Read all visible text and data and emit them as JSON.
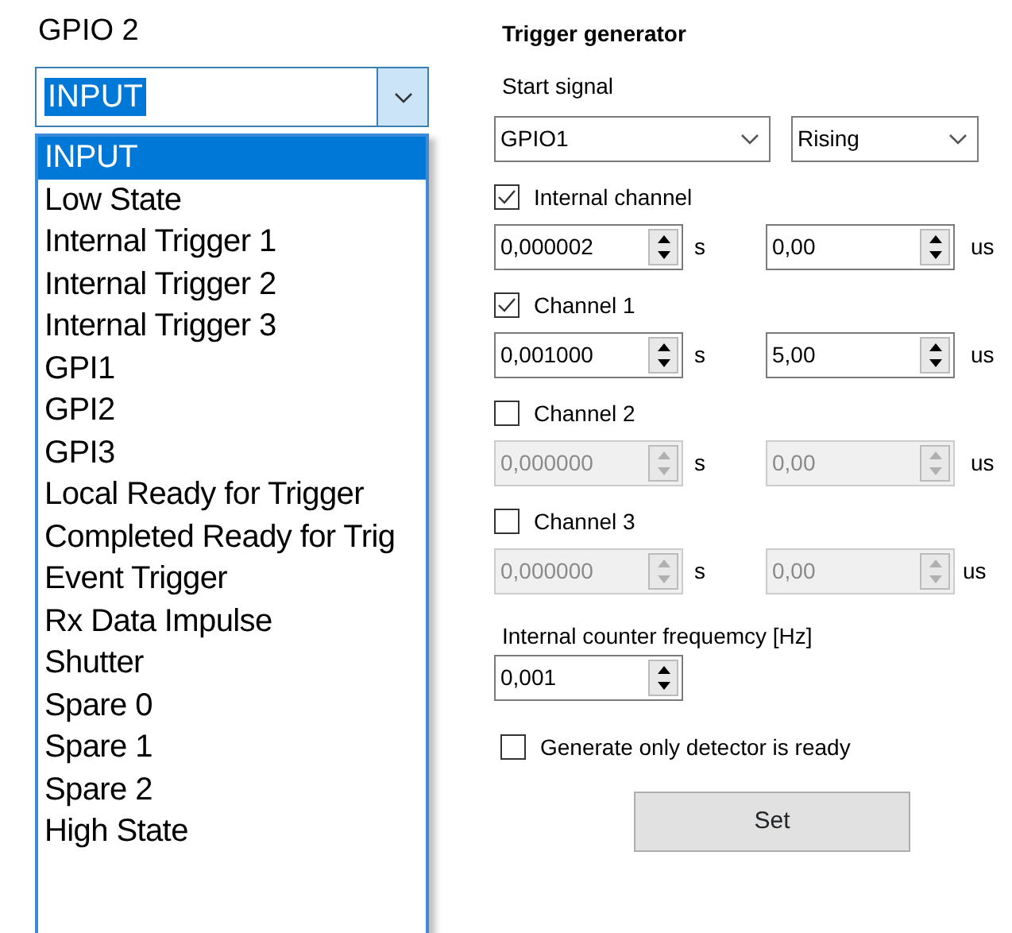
{
  "gpio": {
    "title": "GPIO 2",
    "combo_value": "INPUT",
    "options": [
      {
        "label": "INPUT",
        "selected": true
      },
      {
        "label": "Low State",
        "selected": false
      },
      {
        "label": "Internal Trigger 1",
        "selected": false
      },
      {
        "label": "Internal Trigger 2",
        "selected": false
      },
      {
        "label": "Internal Trigger 3",
        "selected": false
      },
      {
        "label": "GPI1",
        "selected": false
      },
      {
        "label": "GPI2",
        "selected": false
      },
      {
        "label": "GPI3",
        "selected": false
      },
      {
        "label": "Local Ready for Trigger",
        "selected": false
      },
      {
        "label": "Completed Ready for Trig",
        "selected": false
      },
      {
        "label": "Event Trigger",
        "selected": false
      },
      {
        "label": "Rx Data Impulse",
        "selected": false
      },
      {
        "label": "Shutter",
        "selected": false
      },
      {
        "label": "Spare 0",
        "selected": false
      },
      {
        "label": "Spare 1",
        "selected": false
      },
      {
        "label": "Spare 2",
        "selected": false
      },
      {
        "label": "High State",
        "selected": false
      }
    ]
  },
  "trigger": {
    "title": "Trigger generator",
    "start_label": "Start signal",
    "source": "GPIO1",
    "edge": "Rising",
    "channels": [
      {
        "label": "Internal channel",
        "checked": true,
        "disabled": false,
        "seconds": "0,000002",
        "s_unit": "s",
        "delay": "0,00",
        "delay_unit": "us"
      },
      {
        "label": "Channel 1",
        "checked": true,
        "disabled": false,
        "seconds": "0,001000",
        "s_unit": "s",
        "delay": "5,00",
        "delay_unit": "us"
      },
      {
        "label": "Channel 2",
        "checked": false,
        "disabled": true,
        "seconds": "0,000000",
        "s_unit": "s",
        "delay": "0,00",
        "delay_unit": "us"
      },
      {
        "label": "Channel 3",
        "checked": false,
        "disabled": true,
        "seconds": "0,000000",
        "s_unit": "s",
        "delay": "0,00",
        "delay_unit": "us"
      }
    ],
    "freq_label": "Internal counter frequemcy [Hz]",
    "freq": "0,001",
    "generate": {
      "label": "Generate only detector is ready",
      "checked": false
    },
    "set_button": "Set"
  }
}
